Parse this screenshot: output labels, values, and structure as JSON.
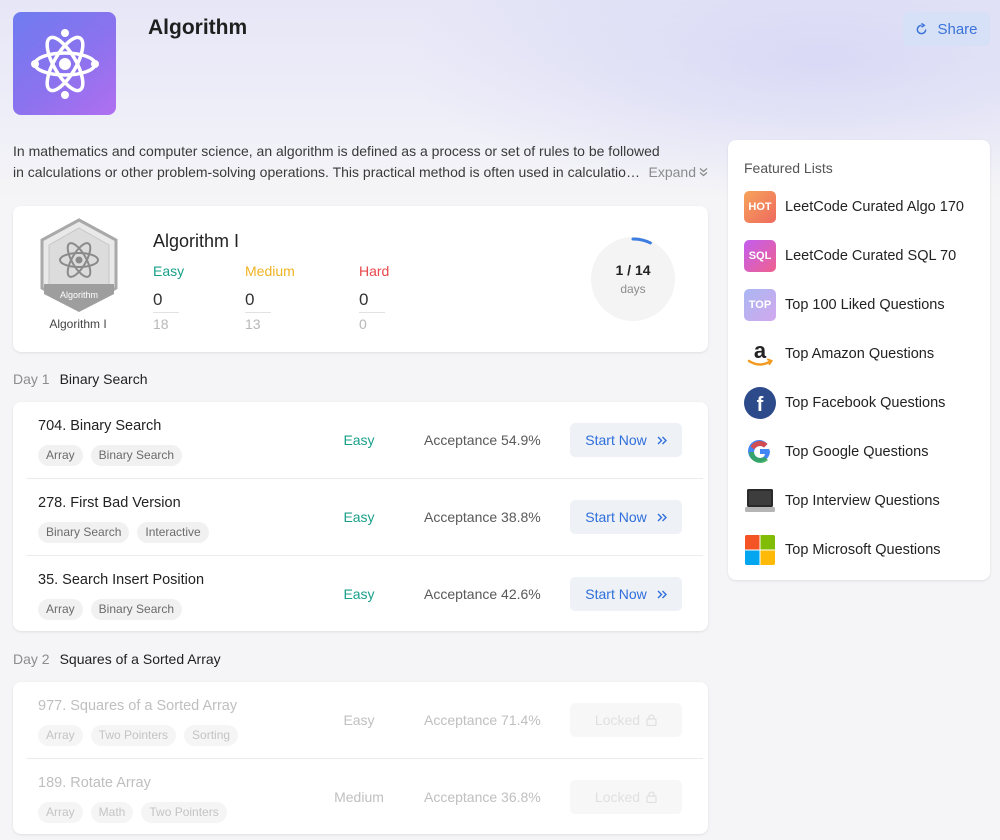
{
  "header": {
    "title": "Algorithm",
    "share_label": "Share"
  },
  "description": {
    "line1": "In mathematics and computer science, an algorithm is defined as a process or set of rules to be followed",
    "line2": "in calculations or other problem-solving operations. This practical method is often used in calculations, data processing, and automated reasoning.",
    "expand_label": "Expand"
  },
  "study_plan": {
    "badge_text": "Algorithm",
    "badge_label": "Algorithm I",
    "title": "Algorithm I",
    "difficulties": [
      {
        "name": "Easy",
        "solved": "0",
        "total": "18",
        "color": "#1aa08a"
      },
      {
        "name": "Medium",
        "solved": "0",
        "total": "13",
        "color": "#f0b323"
      },
      {
        "name": "Hard",
        "solved": "0",
        "total": "0",
        "color": "#e8474c"
      }
    ],
    "progress": {
      "text": "1 / 14",
      "unit": "days",
      "done": 1,
      "total": 14
    }
  },
  "days": [
    {
      "day": "Day 1",
      "topic": "Binary Search",
      "questions": [
        {
          "title": "704. Binary Search",
          "tags": [
            "Array",
            "Binary Search"
          ],
          "difficulty": "Easy",
          "acceptance": "Acceptance 54.9%",
          "action": "Start Now"
        },
        {
          "title": "278. First Bad Version",
          "tags": [
            "Binary Search",
            "Interactive"
          ],
          "difficulty": "Easy",
          "acceptance": "Acceptance 38.8%",
          "action": "Start Now"
        },
        {
          "title": "35. Search Insert Position",
          "tags": [
            "Array",
            "Binary Search"
          ],
          "difficulty": "Easy",
          "acceptance": "Acceptance 42.6%",
          "action": "Start Now"
        }
      ]
    },
    {
      "day": "Day 2",
      "topic": "Squares of a Sorted Array",
      "questions": [
        {
          "title": "977. Squares of a Sorted Array",
          "tags": [
            "Array",
            "Two Pointers",
            "Sorting"
          ],
          "difficulty": "Easy",
          "acceptance": "Acceptance 71.4%",
          "action": "Locked"
        },
        {
          "title": "189. Rotate Array",
          "tags": [
            "Array",
            "Math",
            "Two Pointers"
          ],
          "difficulty": "Medium",
          "acceptance": "Acceptance 36.8%",
          "action": "Locked"
        }
      ]
    }
  ],
  "featured": {
    "title": "Featured Lists",
    "items": [
      {
        "label": "LeetCode Curated Algo 170",
        "icon": "hot-icon",
        "icon_text": "HOT"
      },
      {
        "label": "LeetCode Curated SQL 70",
        "icon": "sql-icon",
        "icon_text": "SQL"
      },
      {
        "label": "Top 100 Liked Questions",
        "icon": "top-icon",
        "icon_text": "TOP"
      },
      {
        "label": "Top Amazon Questions",
        "icon": "amazon-icon",
        "icon_text": "a"
      },
      {
        "label": "Top Facebook Questions",
        "icon": "facebook-icon",
        "icon_text": "f"
      },
      {
        "label": "Top Google Questions",
        "icon": "google-icon",
        "icon_text": "G"
      },
      {
        "label": "Top Interview Questions",
        "icon": "laptop-icon",
        "icon_text": ""
      },
      {
        "label": "Top Microsoft Questions",
        "icon": "microsoft-icon",
        "icon_text": ""
      }
    ]
  }
}
